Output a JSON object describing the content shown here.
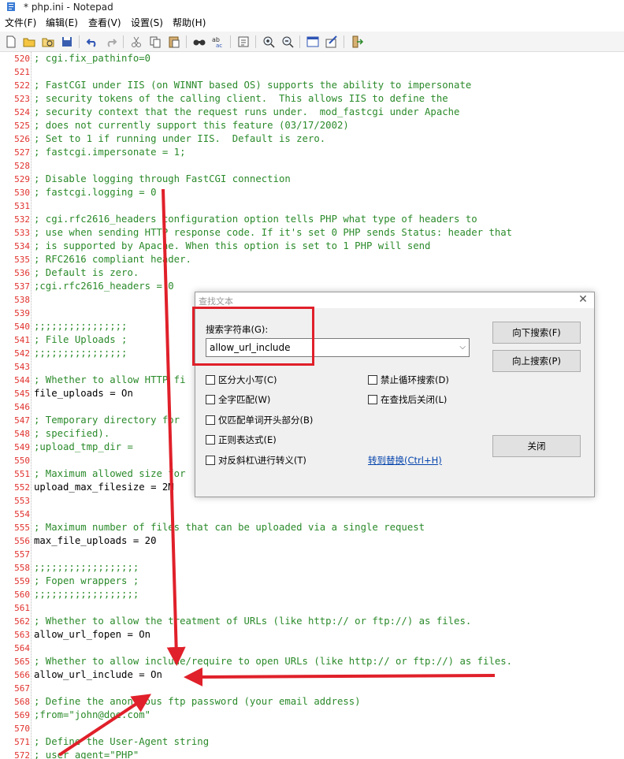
{
  "window": {
    "title": "* php.ini - Notepad"
  },
  "menu": {
    "file": "文件(F)",
    "edit": "编辑(E)",
    "view": "查看(V)",
    "settings": "设置(S)",
    "help": "帮助(H)"
  },
  "toolbar_icons": [
    "new-file-icon",
    "open-file-icon",
    "open-folder-icon",
    "save-icon",
    "undo-icon",
    "redo-icon",
    "cut-icon",
    "copy-icon",
    "paste-icon",
    "find-icon",
    "spellcheck-icon",
    "goto-icon",
    "zoom-in-icon",
    "zoom-out-icon",
    "view-icon",
    "settings-icon",
    "exit-icon"
  ],
  "lines": [
    {
      "n": "520",
      "t": "; cgi.fix_pathinfo=0",
      "c": true
    },
    {
      "n": "521",
      "t": "",
      "c": true
    },
    {
      "n": "522",
      "t": "; FastCGI under IIS (on WINNT based OS) supports the ability to impersonate",
      "c": true
    },
    {
      "n": "523",
      "t": "; security tokens of the calling client.  This allows IIS to define the",
      "c": true
    },
    {
      "n": "524",
      "t": "; security context that the request runs under.  mod_fastcgi under Apache",
      "c": true
    },
    {
      "n": "525",
      "t": "; does not currently support this feature (03/17/2002)",
      "c": true
    },
    {
      "n": "526",
      "t": "; Set to 1 if running under IIS.  Default is zero.",
      "c": true
    },
    {
      "n": "527",
      "t": "; fastcgi.impersonate = 1;",
      "c": true
    },
    {
      "n": "528",
      "t": "",
      "c": true
    },
    {
      "n": "529",
      "t": "; Disable logging through FastCGI connection",
      "c": true
    },
    {
      "n": "530",
      "t": "; fastcgi.logging = 0",
      "c": true
    },
    {
      "n": "531",
      "t": "",
      "c": true
    },
    {
      "n": "532",
      "t": "; cgi.rfc2616_headers configuration option tells PHP what type of headers to",
      "c": true
    },
    {
      "n": "533",
      "t": "; use when sending HTTP response code. If it's set 0 PHP sends Status: header that",
      "c": true
    },
    {
      "n": "534",
      "t": "; is supported by Apache. When this option is set to 1 PHP will send",
      "c": true
    },
    {
      "n": "535",
      "t": "; RFC2616 compliant header.",
      "c": true
    },
    {
      "n": "536",
      "t": "; Default is zero.",
      "c": true
    },
    {
      "n": "537",
      "t": ";cgi.rfc2616_headers = 0",
      "c": true
    },
    {
      "n": "538",
      "t": "",
      "c": true
    },
    {
      "n": "539",
      "t": "",
      "c": true
    },
    {
      "n": "540",
      "t": ";;;;;;;;;;;;;;;;",
      "c": true
    },
    {
      "n": "541",
      "t": "; File Uploads ;",
      "c": true
    },
    {
      "n": "542",
      "t": ";;;;;;;;;;;;;;;;",
      "c": true
    },
    {
      "n": "543",
      "t": "",
      "c": true
    },
    {
      "n": "544",
      "t": "; Whether to allow HTTP fi",
      "c": true
    },
    {
      "n": "545",
      "t": "file_uploads = On",
      "c": false
    },
    {
      "n": "546",
      "t": "",
      "c": true
    },
    {
      "n": "547",
      "t": "; Temporary directory for",
      "c": true
    },
    {
      "n": "548",
      "t": "; specified).",
      "c": true
    },
    {
      "n": "549",
      "t": ";upload_tmp_dir =",
      "c": true
    },
    {
      "n": "550",
      "t": "",
      "c": true
    },
    {
      "n": "551",
      "t": "; Maximum allowed size for",
      "c": true
    },
    {
      "n": "552",
      "t": "upload_max_filesize = 2M",
      "c": false
    },
    {
      "n": "553",
      "t": "",
      "c": true
    },
    {
      "n": "554",
      "t": "",
      "c": true
    },
    {
      "n": "555",
      "t": "; Maximum number of files that can be uploaded via a single request",
      "c": true
    },
    {
      "n": "556",
      "t": "max_file_uploads = 20",
      "c": false
    },
    {
      "n": "557",
      "t": "",
      "c": true
    },
    {
      "n": "558",
      "t": ";;;;;;;;;;;;;;;;;;",
      "c": true
    },
    {
      "n": "559",
      "t": "; Fopen wrappers ;",
      "c": true
    },
    {
      "n": "560",
      "t": ";;;;;;;;;;;;;;;;;;",
      "c": true
    },
    {
      "n": "561",
      "t": "",
      "c": true
    },
    {
      "n": "562",
      "t": "; Whether to allow the treatment of URLs (like http:// or ftp://) as files.",
      "c": true
    },
    {
      "n": "563",
      "t": "allow_url_fopen = On",
      "c": false
    },
    {
      "n": "564",
      "t": "",
      "c": true
    },
    {
      "n": "565",
      "t": "; Whether to allow include/require to open URLs (like http:// or ftp://) as files.",
      "c": true
    },
    {
      "n": "566",
      "t": "allow_url_include = On",
      "c": false
    },
    {
      "n": "567",
      "t": "",
      "c": true
    },
    {
      "n": "568",
      "t": "; Define the anonymous ftp password (your email address)",
      "c": true
    },
    {
      "n": "569",
      "t": ";from=\"john@doe.com\"",
      "c": true
    },
    {
      "n": "570",
      "t": "",
      "c": true
    },
    {
      "n": "571",
      "t": "; Define the User-Agent string",
      "c": true
    },
    {
      "n": "572",
      "t": "; user_agent=\"PHP\"",
      "c": true
    }
  ],
  "find_dialog": {
    "title": "查找文本",
    "search_label": "搜索字符串(G):",
    "search_value": "allow_url_include",
    "find_next": "向下搜索(F)",
    "find_prev": "向上搜索(P)",
    "close": "关闭",
    "options": {
      "match_case": "区分大小写(C)",
      "whole_word": "全字匹配(W)",
      "match_prefix": "仅匹配单词开头部分(B)",
      "regex": "正则表达式(E)",
      "escape_backslash": "对反斜杠\\进行转义(T)",
      "no_wrap": "禁止循环搜索(D)",
      "close_after_find": "在查找后关闭(L)"
    },
    "goto_replace": "转到替换(Ctrl+H)"
  },
  "colors": {
    "line_numbers": "#e0322d",
    "comment": "#2a8a2a",
    "annotation": "#e0202a"
  }
}
